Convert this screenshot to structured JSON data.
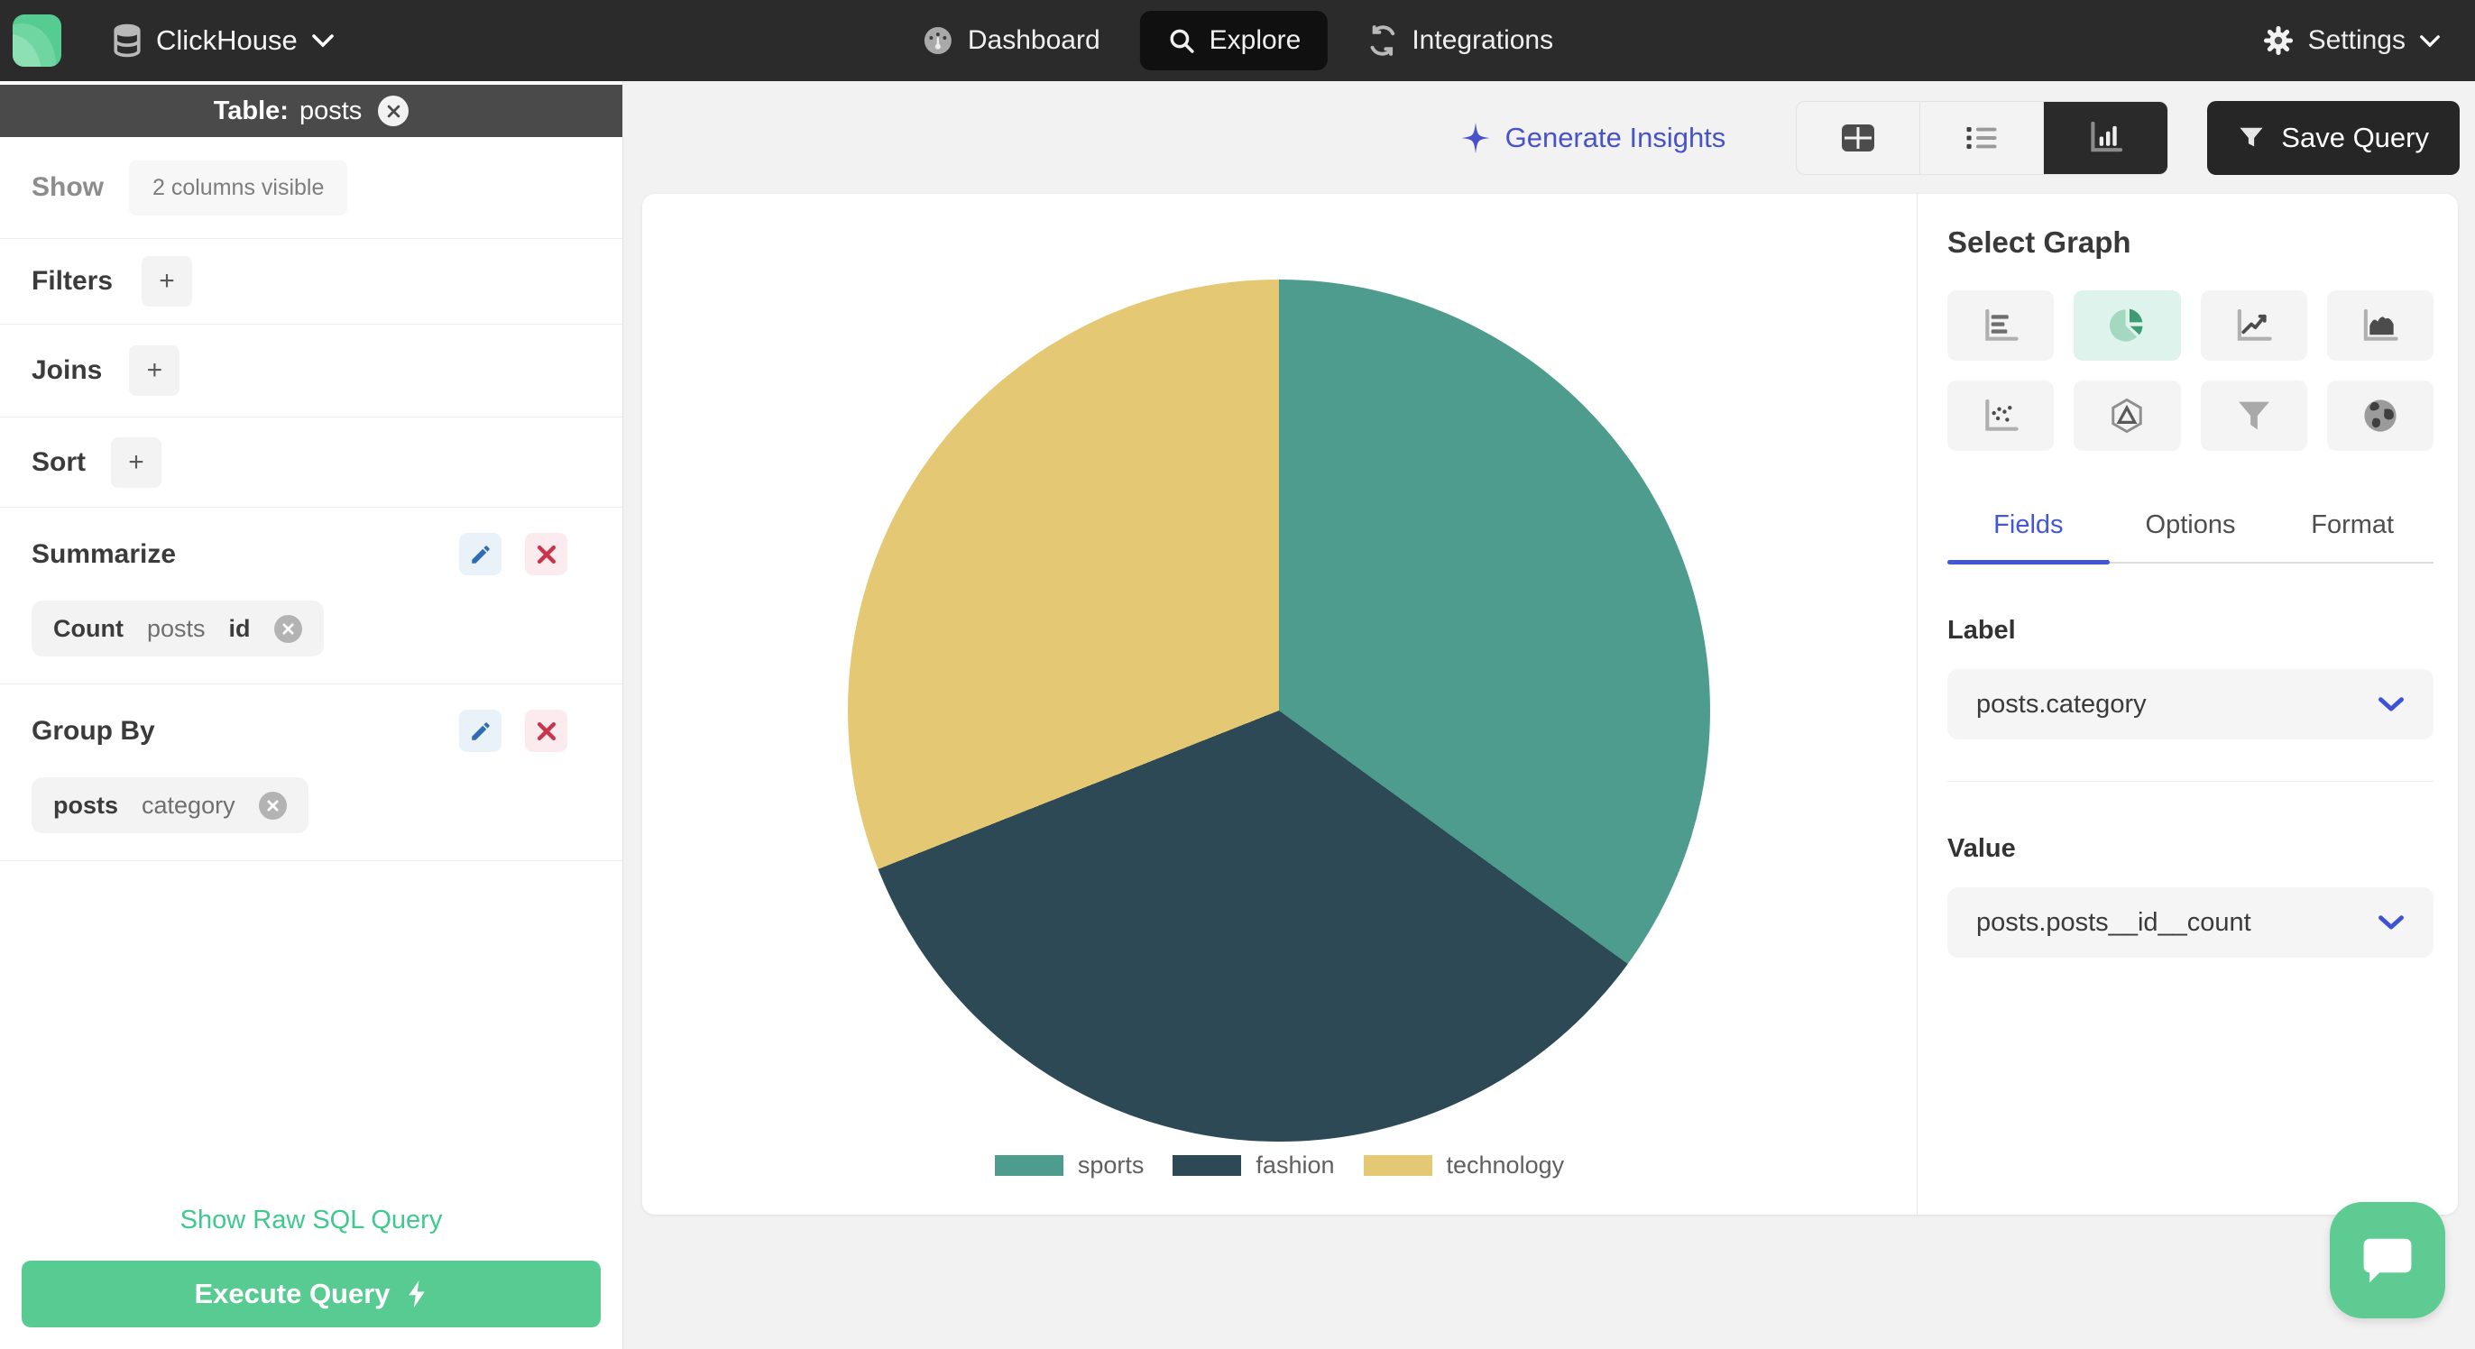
{
  "navbar": {
    "brand": "ClickHouse",
    "items": [
      {
        "label": "Dashboard"
      },
      {
        "label": "Explore"
      },
      {
        "label": "Integrations"
      }
    ],
    "settings_label": "Settings"
  },
  "sidebar": {
    "table_header": {
      "prefix": "Table:",
      "name": "posts"
    },
    "show": {
      "label": "Show",
      "badge": "2 columns visible"
    },
    "filters": {
      "label": "Filters",
      "add": "+"
    },
    "joins": {
      "label": "Joins",
      "add": "+"
    },
    "sort": {
      "label": "Sort",
      "add": "+"
    },
    "summarize": {
      "label": "Summarize",
      "chip": {
        "agg": "Count",
        "table": "posts",
        "column": "id"
      }
    },
    "group_by": {
      "label": "Group By",
      "chip": {
        "table": "posts",
        "column": "category"
      }
    },
    "raw_sql_link": "Show Raw SQL Query",
    "execute_button": "Execute Query"
  },
  "toolbar": {
    "generate_insights": "Generate Insights",
    "save_query": "Save Query"
  },
  "right_panel": {
    "title": "Select Graph",
    "graph_types": [
      "bar",
      "pie",
      "line",
      "area",
      "scatter",
      "radar",
      "funnel",
      "map"
    ],
    "active_graph": "pie",
    "tabs": [
      {
        "label": "Fields",
        "active": true
      },
      {
        "label": "Options",
        "active": false
      },
      {
        "label": "Format",
        "active": false
      }
    ],
    "label_field": {
      "label": "Label",
      "value": "posts.category"
    },
    "value_field": {
      "label": "Value",
      "value": "posts.posts__id__count"
    }
  },
  "chart_data": {
    "type": "pie",
    "title": "",
    "series": [
      {
        "name": "sports",
        "value": 35,
        "color": "#4e9c8e"
      },
      {
        "name": "fashion",
        "value": 34,
        "color": "#2c4955"
      },
      {
        "name": "technology",
        "value": 31,
        "color": "#e5c873"
      }
    ],
    "start_angle_deg": 0,
    "direction": "clockwise",
    "legend_position": "bottom",
    "values_unit": "percent_estimate"
  },
  "colors": {
    "accent_green": "#57cb92",
    "accent_blue": "#4356d6",
    "navbar_bg": "#2b2b2b",
    "danger": "#c9344a"
  }
}
